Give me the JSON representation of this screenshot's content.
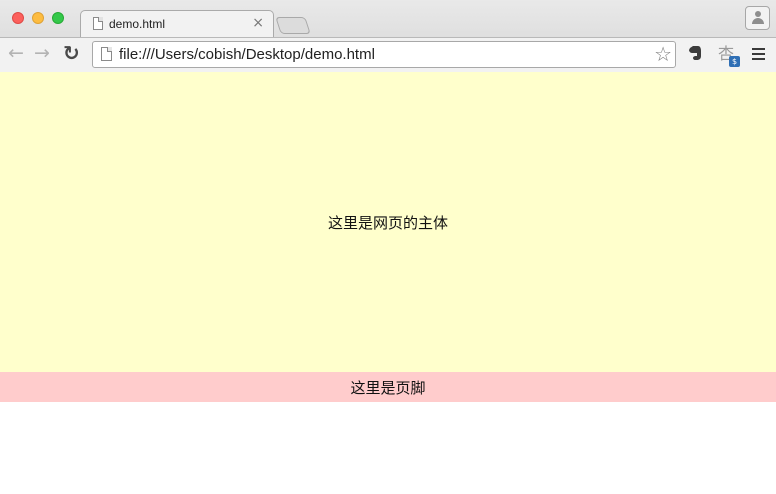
{
  "window": {
    "controls": [
      "close",
      "minimize",
      "maximize"
    ]
  },
  "tabs": [
    {
      "title": "demo.html",
      "active": true,
      "close_label": "×"
    }
  ],
  "toolbar": {
    "back_glyph": "←",
    "forward_glyph": "→",
    "reload_glyph": "↻",
    "address": "file:///Users/cobish/Desktop/demo.html",
    "bookmark_glyph": "☆",
    "extensions": [
      "evernote-icon",
      "translate-icon"
    ],
    "translate_glyph": "杏",
    "translate_badge": "$",
    "menu": "menu-icon"
  },
  "page": {
    "main_text": "这里是网页的主体",
    "footer_text": "这里是页脚",
    "colors": {
      "main_bg": "#ffffcc",
      "footer_bg": "#ffcccc"
    }
  }
}
